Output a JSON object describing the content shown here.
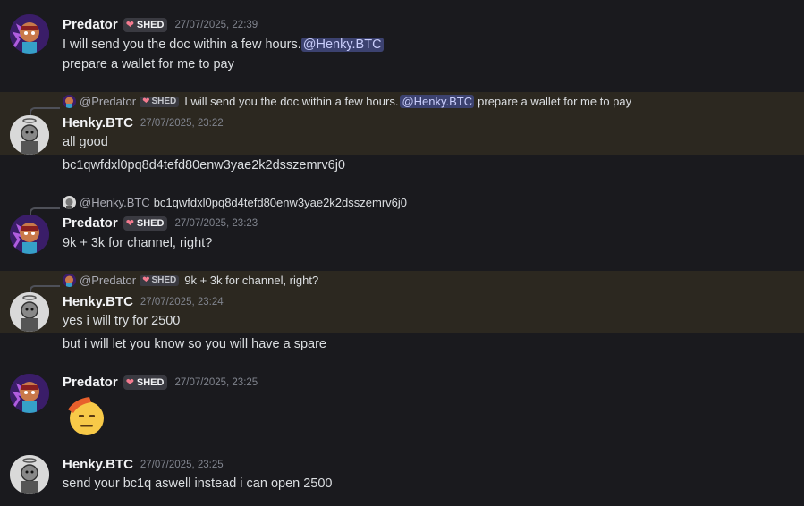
{
  "users": {
    "predator": {
      "name": "Predator",
      "tag": "SHED",
      "mention": "@Predator"
    },
    "henky": {
      "name": "Henky.BTC",
      "mention": "@Henky.BTC"
    }
  },
  "messages": [
    {
      "author": "Predator",
      "tag": "SHED",
      "time": "27/07/2025, 22:39",
      "line1_text": "I will send you the doc within a few hours.",
      "line1_mention": "@Henky.BTC",
      "line2": "prepare a wallet for me to pay"
    },
    {
      "reply": {
        "name": "@Predator",
        "tag": "SHED",
        "text": "I will send you the doc within a few hours.",
        "mention": "@Henky.BTC",
        "text2": "prepare a wallet for me to pay"
      },
      "author": "Henky.BTC",
      "time": "27/07/2025, 23:22",
      "line1": "all good",
      "line2": "bc1qwfdxl0pq8d4tefd80enw3yae2k2dsszemrv6j0"
    },
    {
      "reply": {
        "name": "@Henky.BTC",
        "text": "bc1qwfdxl0pq8d4tefd80enw3yae2k2dsszemrv6j0"
      },
      "author": "Predator",
      "tag": "SHED",
      "time": "27/07/2025, 23:23",
      "line1": "9k + 3k for channel, right?"
    },
    {
      "reply": {
        "name": "@Predator",
        "tag": "SHED",
        "text": "9k + 3k for channel, right?"
      },
      "author": "Henky.BTC",
      "time": "27/07/2025, 23:24",
      "line1": "yes i will try for 2500",
      "line2": "but i will let you know so you will have a spare"
    },
    {
      "author": "Predator",
      "tag": "SHED",
      "time": "27/07/2025, 23:25",
      "emoji": "saluting-face"
    },
    {
      "author": "Henky.BTC",
      "time": "27/07/2025, 23:25",
      "line1": "send your bc1q aswell instead i can open 2500"
    }
  ],
  "colors": {
    "background": "#1a1a1e",
    "highlight": "#2c2820",
    "mention_bg": "#3c4270",
    "mention_fg": "#c9cdfb",
    "heart": "#f47b8f"
  }
}
